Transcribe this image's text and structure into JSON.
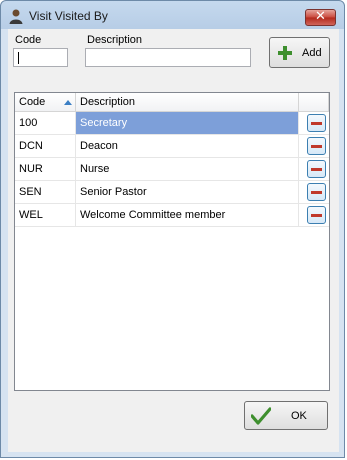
{
  "window": {
    "title": "Visit Visited By",
    "close_glyph": "✕"
  },
  "form": {
    "code_label": "Code",
    "description_label": "Description",
    "code_value": "",
    "description_value": "",
    "add_label": "Add"
  },
  "grid": {
    "columns": [
      "Code",
      "Description"
    ],
    "sorted_column": "Code",
    "rows": [
      {
        "code": "100",
        "description": "Secretary",
        "selected": true
      },
      {
        "code": "DCN",
        "description": "Deacon",
        "selected": false
      },
      {
        "code": "NUR",
        "description": "Nurse",
        "selected": false
      },
      {
        "code": "SEN",
        "description": "Senior Pastor",
        "selected": false
      },
      {
        "code": "WEL",
        "description": "Welcome Committee member",
        "selected": false
      }
    ]
  },
  "footer": {
    "ok_label": "OK"
  },
  "colors": {
    "selection": "#7d9fd9",
    "accent": "#3b7fc4",
    "remove": "#c0392b",
    "ok_check": "#3e8f2e"
  },
  "icons": [
    "user-icon",
    "close-icon",
    "plus-icon",
    "sort-ascending-icon",
    "minus-icon",
    "checkmark-icon"
  ]
}
